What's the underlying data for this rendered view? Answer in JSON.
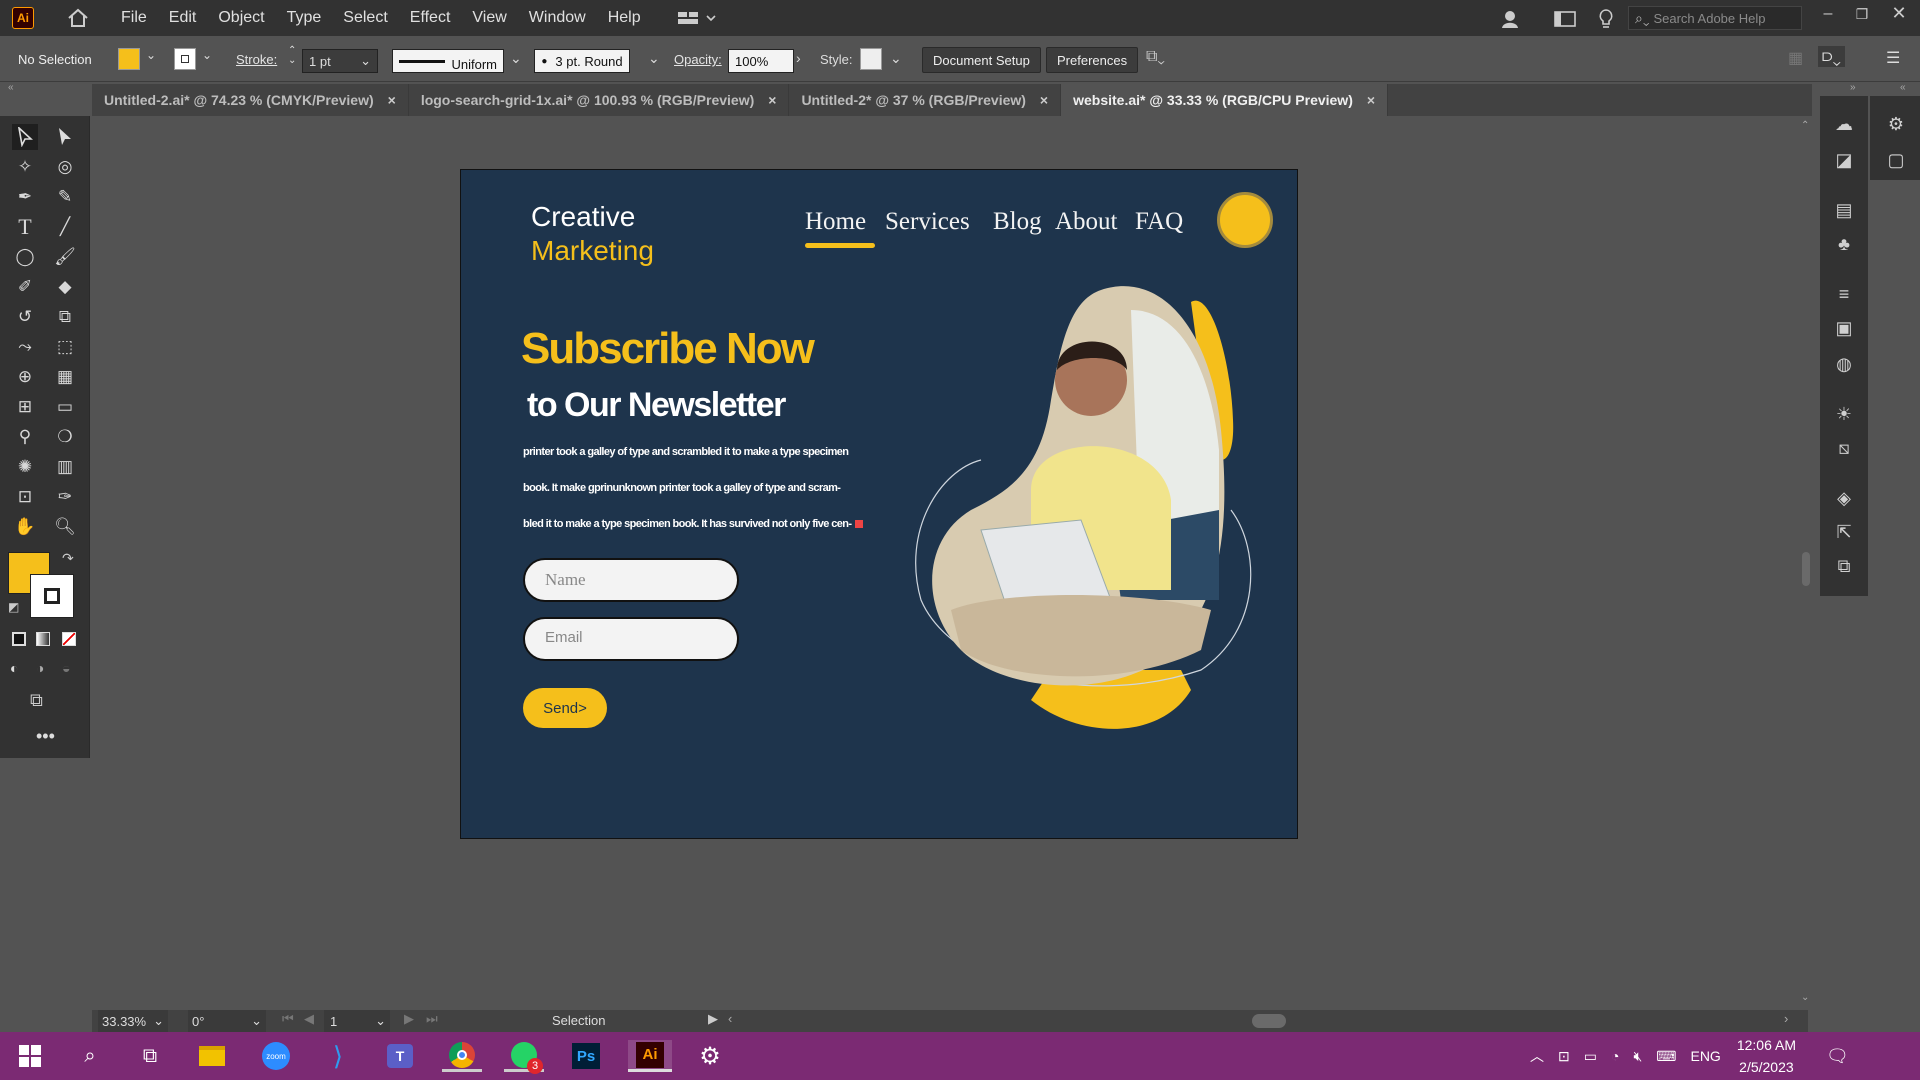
{
  "app": {
    "logo": "Ai",
    "search_placeholder": "Search Adobe Help"
  },
  "menu": [
    "File",
    "Edit",
    "Object",
    "Type",
    "Select",
    "Effect",
    "View",
    "Window",
    "Help"
  ],
  "control": {
    "selection": "No Selection",
    "fill_color": "#f5bf1b",
    "stroke_label": "Stroke:",
    "stroke_weight": "1 pt",
    "profile": "Uniform",
    "brush": "3 pt. Round",
    "opacity_label": "Opacity:",
    "opacity": "100%",
    "style_label": "Style:",
    "doc_setup": "Document Setup",
    "preferences": "Preferences"
  },
  "tabs": [
    {
      "label": "Untitled-2.ai* @ 74.23 % (CMYK/Preview)",
      "active": false
    },
    {
      "label": "logo-search-grid-1x.ai* @ 100.93 % (RGB/Preview)",
      "active": false
    },
    {
      "label": "Untitled-2* @ 37 % (RGB/Preview)",
      "active": false
    },
    {
      "label": "website.ai* @ 33.33 % (RGB/CPU Preview)",
      "active": true
    }
  ],
  "tab_close": "×",
  "status": {
    "zoom": "33.33%",
    "rotation": "0°",
    "artboard": "1",
    "tool": "Selection"
  },
  "artboard": {
    "logo_line1": "Creative",
    "logo_line2": "Marketing",
    "nav": [
      "Home",
      "Services",
      "Blog",
      "About",
      "FAQ"
    ],
    "headline1": "Subscribe Now",
    "headline2": "to Our Newsletter",
    "body_lines": [
      "printer took a galley of type and scrambled it to make a type specimen",
      "book. It make gprinunknown printer took a galley of type and scram-",
      "bled it to make a type specimen book. It has survived not only five cen-"
    ],
    "name_placeholder": "Name",
    "email_placeholder": "Email",
    "send_label": "Send>",
    "accent": "#f5bf1b",
    "bg": "#1e344c"
  },
  "taskbar": {
    "lang": "ENG",
    "time": "12:06 AM",
    "date": "2/5/2023",
    "whatsapp_badge": "3",
    "zoom_label": "zoom",
    "ps": "Ps",
    "ai": "Ai"
  }
}
